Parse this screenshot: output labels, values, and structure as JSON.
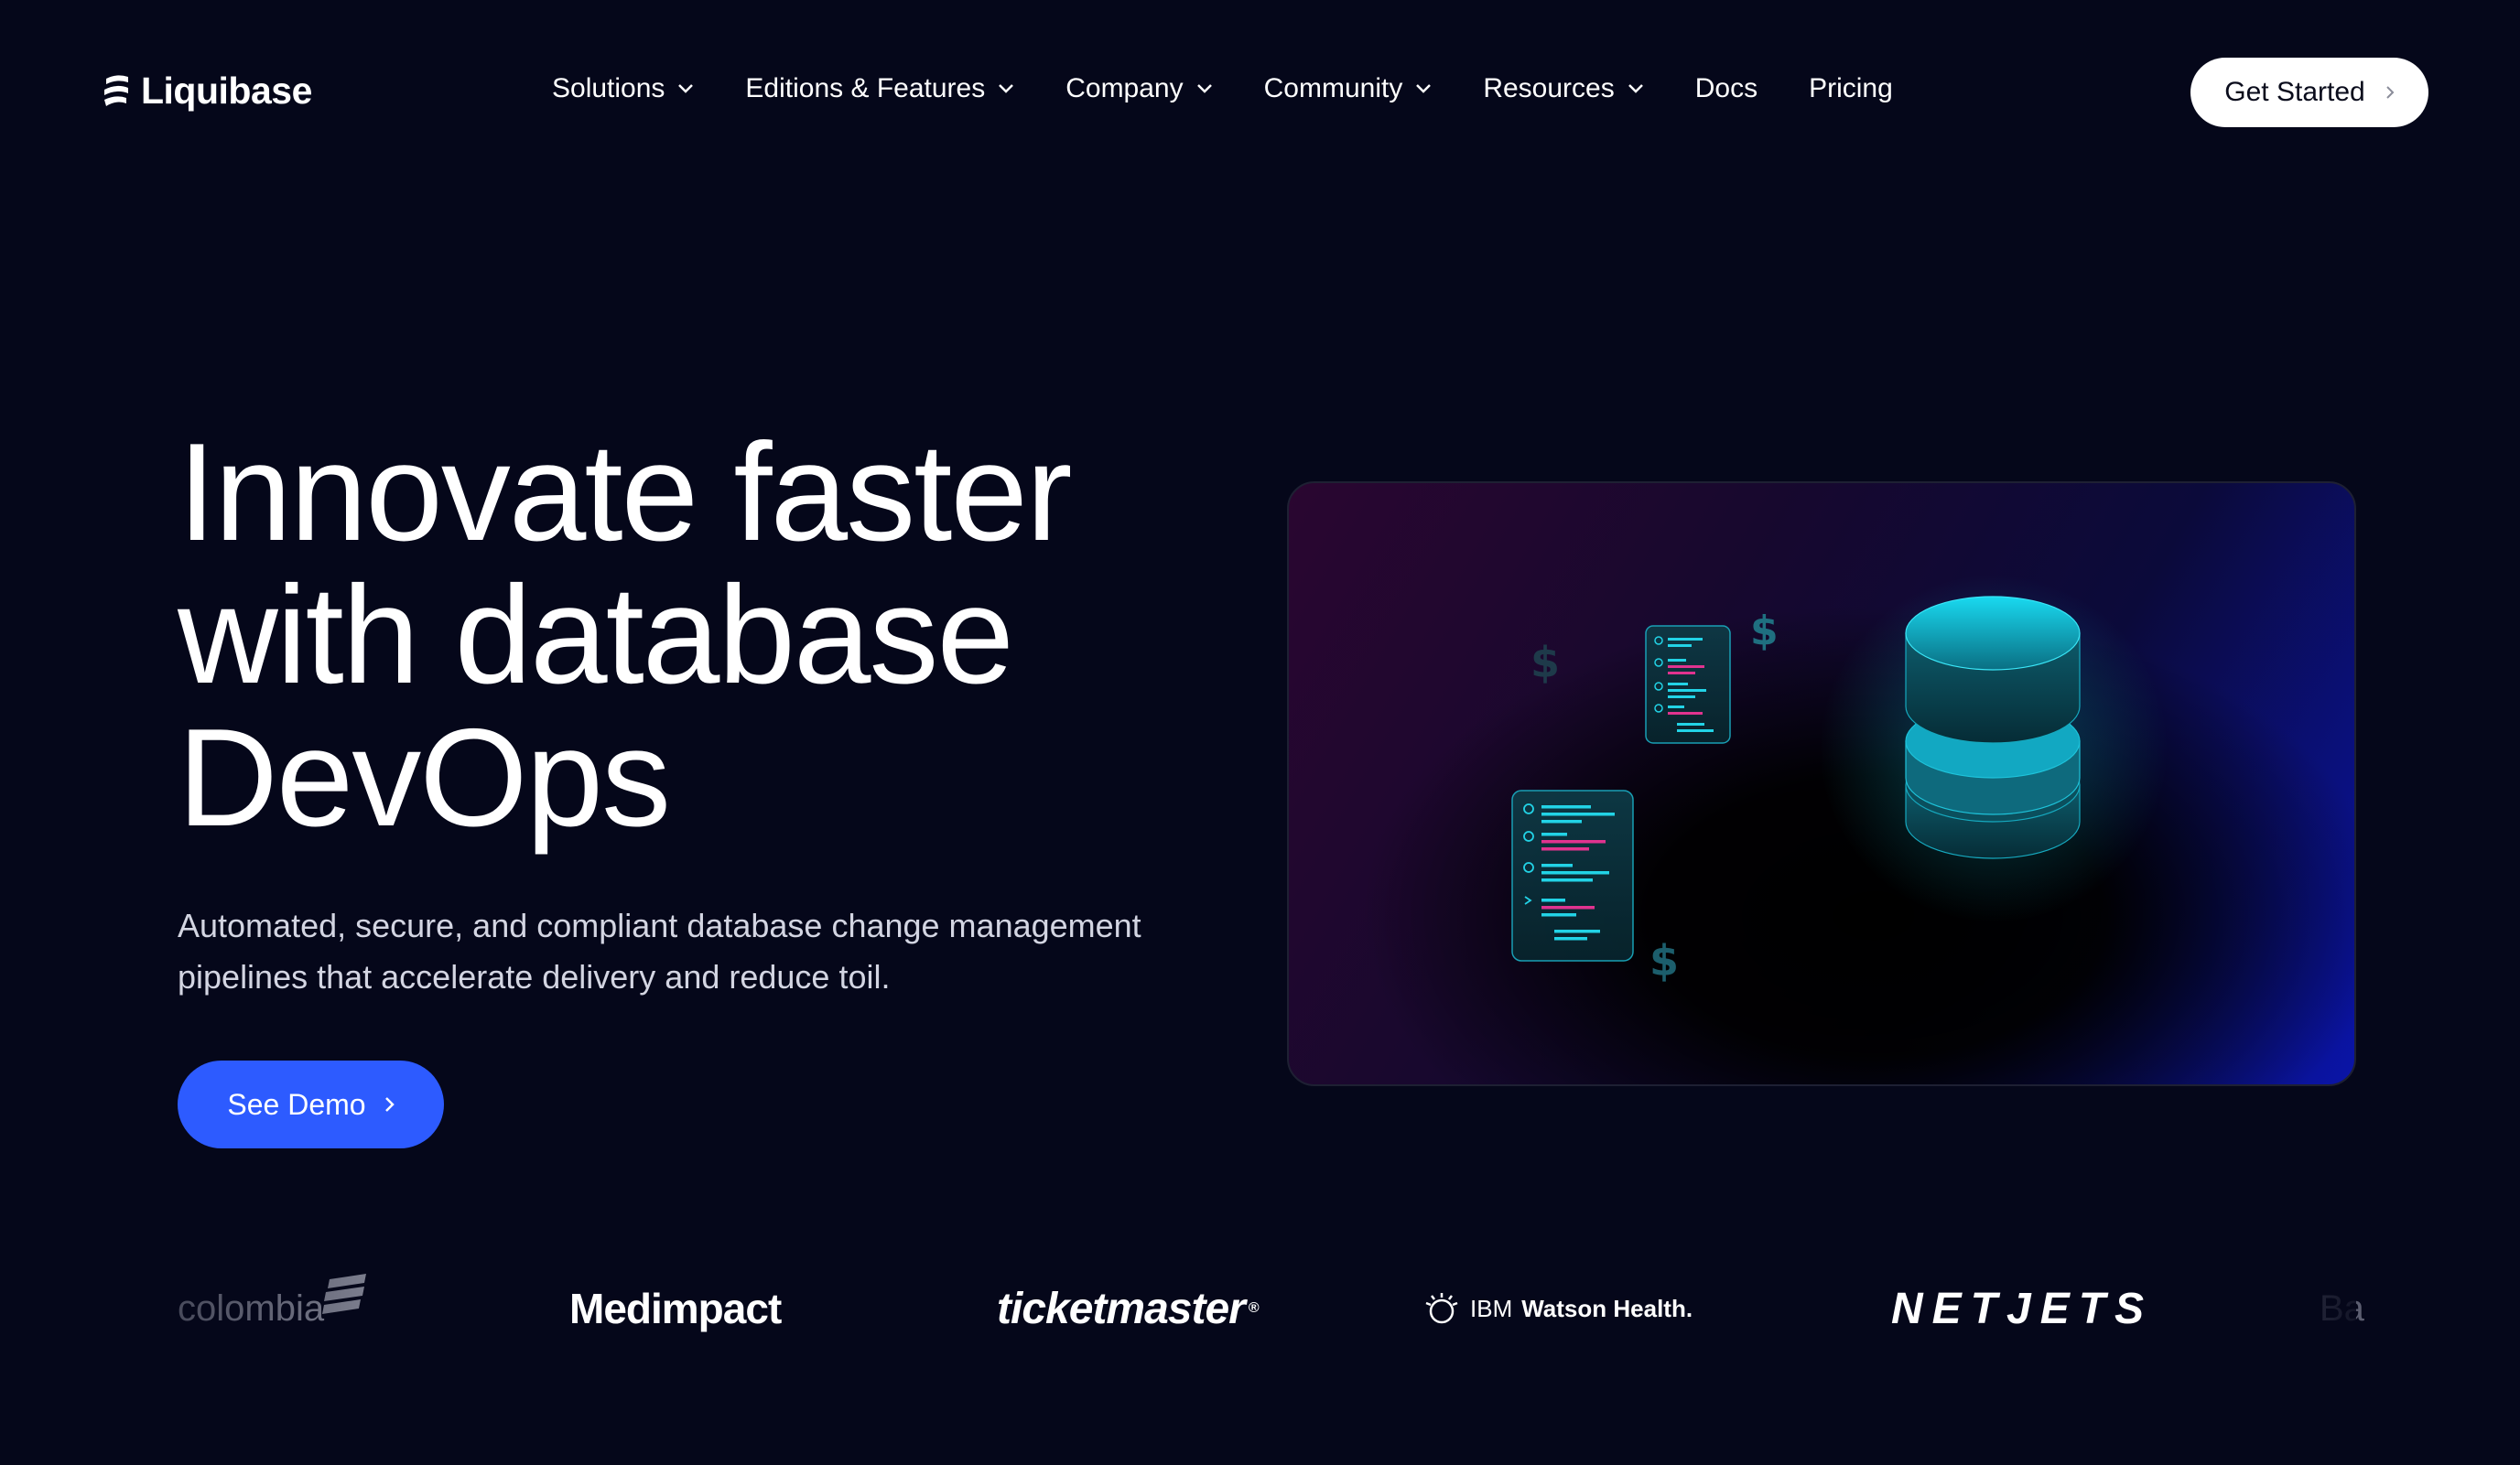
{
  "nav": {
    "brand": "Liquibase",
    "items": [
      {
        "label": "Solutions",
        "has_dropdown": true
      },
      {
        "label": "Editions & Features",
        "has_dropdown": true
      },
      {
        "label": "Company",
        "has_dropdown": true
      },
      {
        "label": "Community",
        "has_dropdown": true
      },
      {
        "label": "Resources",
        "has_dropdown": true
      },
      {
        "label": "Docs",
        "has_dropdown": false
      },
      {
        "label": "Pricing",
        "has_dropdown": false
      }
    ],
    "cta_label": "Get Started"
  },
  "hero": {
    "title_lines": [
      "Innovate faster",
      "with database",
      "DevOps"
    ],
    "subtitle_lines": [
      "Automated, secure, and compliant database change management",
      "pipelines that accelerate delivery and reduce toil."
    ],
    "cta_label": "See Demo"
  },
  "illustration": {
    "currency_symbol": "$",
    "icons": [
      "code-file-icon",
      "database-icon",
      "dollar-icon"
    ]
  },
  "customer_logos": {
    "colombia": "colombia",
    "medimpact": "Medimpact",
    "ticketmaster": "ticketmaster",
    "ticketmaster_mark": "®",
    "ibm_prefix": "IBM",
    "ibm_name": "Watson Health.",
    "netjets": "NETJETS",
    "partial": "Ba"
  },
  "colors": {
    "background": "#05071a",
    "primary_button": "#2d5bff",
    "nav_button": "#ffffff",
    "accent_cyan": "#22d3e6",
    "accent_pink": "#e0338f"
  }
}
